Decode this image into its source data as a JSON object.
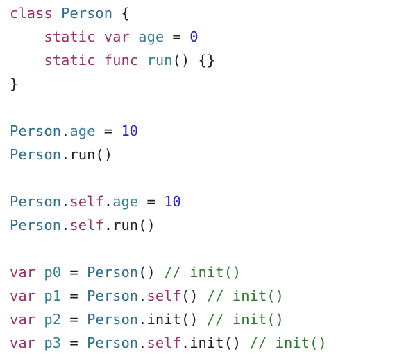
{
  "editor": {
    "lines": [
      [
        [
          "kw",
          "class"
        ],
        [
          "plain",
          " "
        ],
        [
          "type",
          "Person"
        ],
        [
          "plain",
          " {"
        ]
      ],
      [
        [
          "plain",
          "    "
        ],
        [
          "kw",
          "static"
        ],
        [
          "plain",
          " "
        ],
        [
          "kw",
          "var"
        ],
        [
          "plain",
          " "
        ],
        [
          "prop",
          "age"
        ],
        [
          "plain",
          " = "
        ],
        [
          "num",
          "0"
        ]
      ],
      [
        [
          "plain",
          "    "
        ],
        [
          "kw",
          "static"
        ],
        [
          "plain",
          " "
        ],
        [
          "kw",
          "func"
        ],
        [
          "plain",
          " "
        ],
        [
          "prop",
          "run"
        ],
        [
          "plain",
          "() {}"
        ]
      ],
      [
        [
          "plain",
          "}"
        ]
      ],
      [],
      [
        [
          "type",
          "Person"
        ],
        [
          "plain",
          "."
        ],
        [
          "prop",
          "age"
        ],
        [
          "plain",
          " = "
        ],
        [
          "num",
          "10"
        ]
      ],
      [
        [
          "type",
          "Person"
        ],
        [
          "plain",
          ".run()"
        ]
      ],
      [],
      [
        [
          "type",
          "Person"
        ],
        [
          "plain",
          "."
        ],
        [
          "kw",
          "self"
        ],
        [
          "plain",
          "."
        ],
        [
          "prop",
          "age"
        ],
        [
          "plain",
          " = "
        ],
        [
          "num",
          "10"
        ]
      ],
      [
        [
          "type",
          "Person"
        ],
        [
          "plain",
          "."
        ],
        [
          "kw",
          "self"
        ],
        [
          "plain",
          ".run()"
        ]
      ],
      [],
      [
        [
          "kw",
          "var"
        ],
        [
          "plain",
          " "
        ],
        [
          "prop",
          "p0"
        ],
        [
          "plain",
          " = "
        ],
        [
          "type",
          "Person"
        ],
        [
          "plain",
          "() "
        ],
        [
          "com",
          "// init()"
        ]
      ],
      [
        [
          "kw",
          "var"
        ],
        [
          "plain",
          " "
        ],
        [
          "prop",
          "p1"
        ],
        [
          "plain",
          " = "
        ],
        [
          "type",
          "Person"
        ],
        [
          "plain",
          "."
        ],
        [
          "kw",
          "self"
        ],
        [
          "plain",
          "() "
        ],
        [
          "com",
          "// init()"
        ]
      ],
      [
        [
          "kw",
          "var"
        ],
        [
          "plain",
          " "
        ],
        [
          "prop",
          "p2"
        ],
        [
          "plain",
          " = "
        ],
        [
          "type",
          "Person"
        ],
        [
          "plain",
          ".init() "
        ],
        [
          "com",
          "// init()"
        ]
      ],
      [
        [
          "kw",
          "var"
        ],
        [
          "plain",
          " "
        ],
        [
          "prop",
          "p3"
        ],
        [
          "plain",
          " = "
        ],
        [
          "type",
          "Person"
        ],
        [
          "plain",
          "."
        ],
        [
          "kw",
          "self"
        ],
        [
          "plain",
          ".init() "
        ],
        [
          "com",
          "// init()"
        ]
      ]
    ]
  }
}
